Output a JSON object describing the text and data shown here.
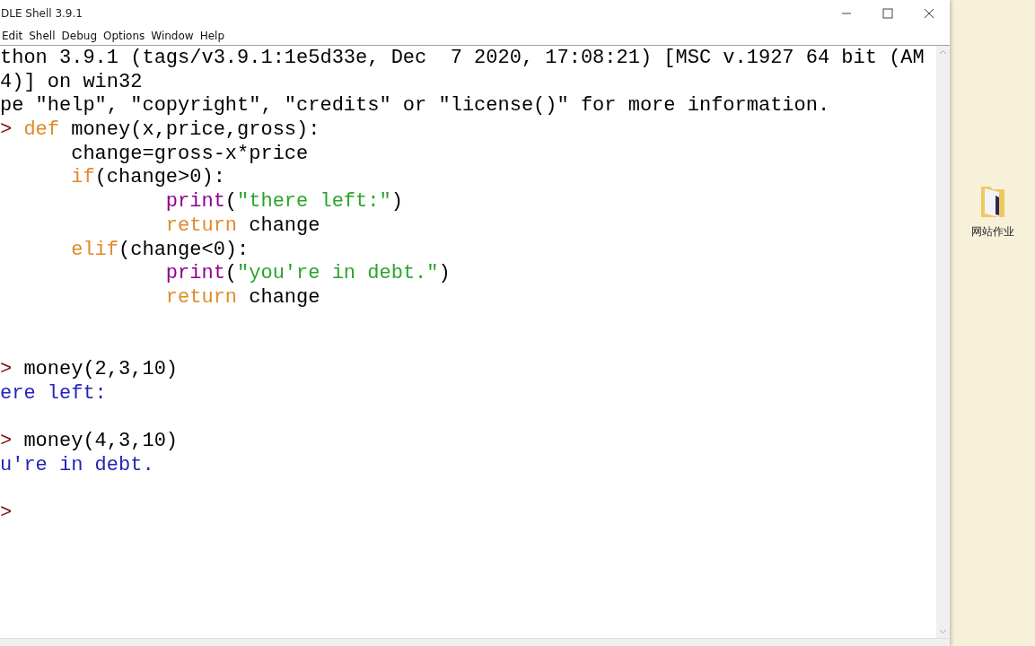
{
  "window": {
    "title": "DLE Shell 3.9.1"
  },
  "menu": [
    "Edit",
    "Shell",
    "Debug",
    "Options",
    "Window",
    "Help"
  ],
  "lines": [
    {
      "kind": "text",
      "segments": [
        {
          "kind": "plain",
          "text": "thon 3.9.1 (tags/v3.9.1:1e5d33e, Dec  7 2020, 17:08:21) [MSC v.1927 64 bit (AM"
        }
      ]
    },
    {
      "kind": "text",
      "segments": [
        {
          "kind": "plain",
          "text": "4)] on win32"
        }
      ]
    },
    {
      "kind": "text",
      "segments": [
        {
          "kind": "plain",
          "text": "pe \"help\", \"copyright\", \"credits\" or \"license()\" for more information."
        }
      ]
    },
    {
      "kind": "text",
      "segments": [
        {
          "kind": "prompt",
          "text": ">"
        },
        {
          "kind": "keyword",
          "text": " def"
        },
        {
          "kind": "plain",
          "text": " money(x,price,gross):"
        }
      ]
    },
    {
      "kind": "text",
      "segments": [
        {
          "kind": "plain",
          "text": "      change=gross-x*price"
        }
      ]
    },
    {
      "kind": "text",
      "segments": [
        {
          "kind": "keyword",
          "text": "      if"
        },
        {
          "kind": "plain",
          "text": "(change>0):"
        }
      ]
    },
    {
      "kind": "text",
      "segments": [
        {
          "kind": "builtin",
          "text": "              print"
        },
        {
          "kind": "plain",
          "text": "("
        },
        {
          "kind": "string",
          "text": "\"there left:\""
        },
        {
          "kind": "plain",
          "text": ")"
        }
      ]
    },
    {
      "kind": "text",
      "segments": [
        {
          "kind": "keyword",
          "text": "              return"
        },
        {
          "kind": "plain",
          "text": " change"
        }
      ]
    },
    {
      "kind": "text",
      "segments": [
        {
          "kind": "keyword",
          "text": "      elif"
        },
        {
          "kind": "plain",
          "text": "(change<0):"
        }
      ]
    },
    {
      "kind": "text",
      "segments": [
        {
          "kind": "builtin",
          "text": "              print"
        },
        {
          "kind": "plain",
          "text": "("
        },
        {
          "kind": "string",
          "text": "\"you're in debt.\""
        },
        {
          "kind": "plain",
          "text": ")"
        }
      ]
    },
    {
      "kind": "text",
      "segments": [
        {
          "kind": "keyword",
          "text": "              return"
        },
        {
          "kind": "plain",
          "text": " change"
        }
      ]
    },
    {
      "kind": "blank"
    },
    {
      "kind": "blank"
    },
    {
      "kind": "text",
      "segments": [
        {
          "kind": "prompt",
          "text": ">"
        },
        {
          "kind": "plain",
          "text": " money(2,3,10)"
        }
      ]
    },
    {
      "kind": "text",
      "segments": [
        {
          "kind": "output",
          "text": "ere left:"
        }
      ]
    },
    {
      "kind": "blank"
    },
    {
      "kind": "text",
      "segments": [
        {
          "kind": "prompt",
          "text": ">"
        },
        {
          "kind": "plain",
          "text": " money(4,3,10)"
        }
      ]
    },
    {
      "kind": "text",
      "segments": [
        {
          "kind": "output",
          "text": "u're in debt."
        }
      ]
    },
    {
      "kind": "blank"
    },
    {
      "kind": "text",
      "segments": [
        {
          "kind": "prompt",
          "text": ">"
        }
      ]
    }
  ],
  "desktop": {
    "icons": [
      {
        "label": "网站作业"
      }
    ]
  }
}
